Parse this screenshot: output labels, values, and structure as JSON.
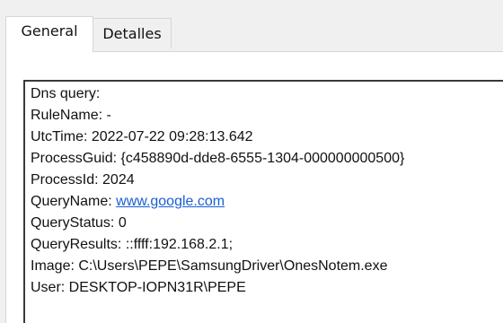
{
  "tabs": [
    {
      "label": "General",
      "active": true
    },
    {
      "label": "Detalles",
      "active": false
    }
  ],
  "event": {
    "line0": "Dns query:",
    "line1": "RuleName: -",
    "line2": "UtcTime: 2022-07-22 09:28:13.642",
    "line3": "ProcessGuid: {c458890d-dde8-6555-1304-000000000500}",
    "line4": "ProcessId: 2024",
    "query_name_label": "QueryName: ",
    "query_name_value": "www.google.com",
    "line6": "QueryStatus: 0",
    "line7": "QueryResults: ::ffff:192.168.2.1;",
    "line8": "Image: C:\\Users\\PEPE\\SamsungDriver\\OnesNotem.exe",
    "line9": "User: DESKTOP-IOPN31R\\PEPE"
  },
  "colors": {
    "link": "#1a5fd6",
    "tab_border": "#d6d6d6",
    "window_bg": "#f0f0f0"
  }
}
